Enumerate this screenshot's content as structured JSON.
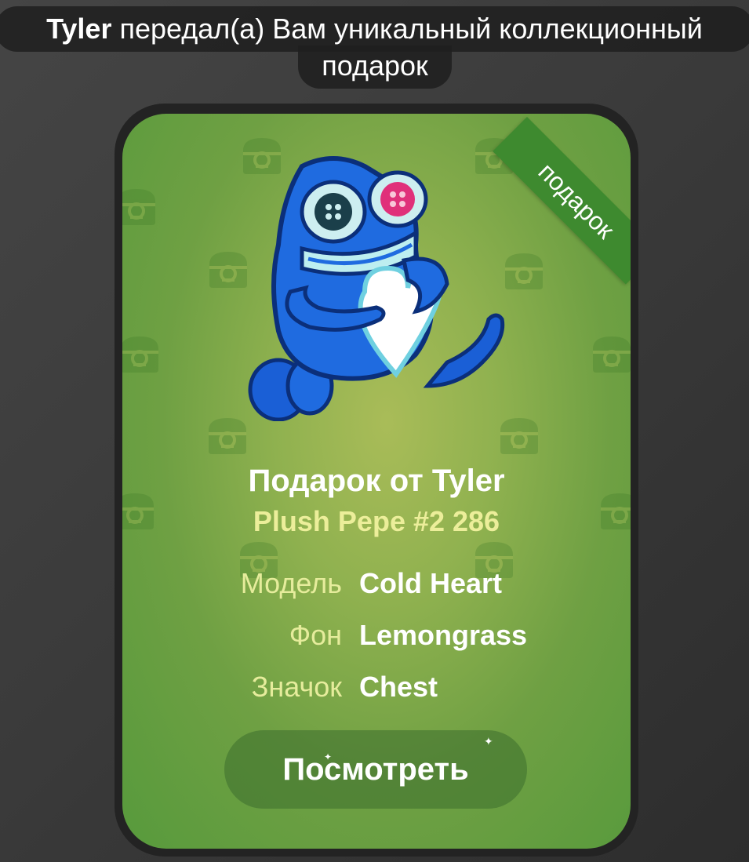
{
  "service_message": {
    "sender": "Tyler",
    "text_line1": " передал(а) Вам уникальный коллекционный",
    "text_line2": "подарок"
  },
  "gift_card": {
    "ribbon_label": "подарок",
    "title": "Подарок от Tyler",
    "subtitle": "Plush Pepe #2 286",
    "attributes": [
      {
        "label": "Модель",
        "value": "Cold Heart"
      },
      {
        "label": "Фон",
        "value": "Lemongrass"
      },
      {
        "label": "Значок",
        "value": "Chest"
      }
    ],
    "view_button_label": "Посмотреть",
    "sticker_icon": "plush-pepe-sticker",
    "pattern_icon": "chest-icon",
    "colors": {
      "background_center": "#a9bc58",
      "background_edge": "#579a3c",
      "ribbon": "#3e8a2f",
      "label_text": "#e6ec9c",
      "subtitle_text": "#ecee9a"
    }
  }
}
